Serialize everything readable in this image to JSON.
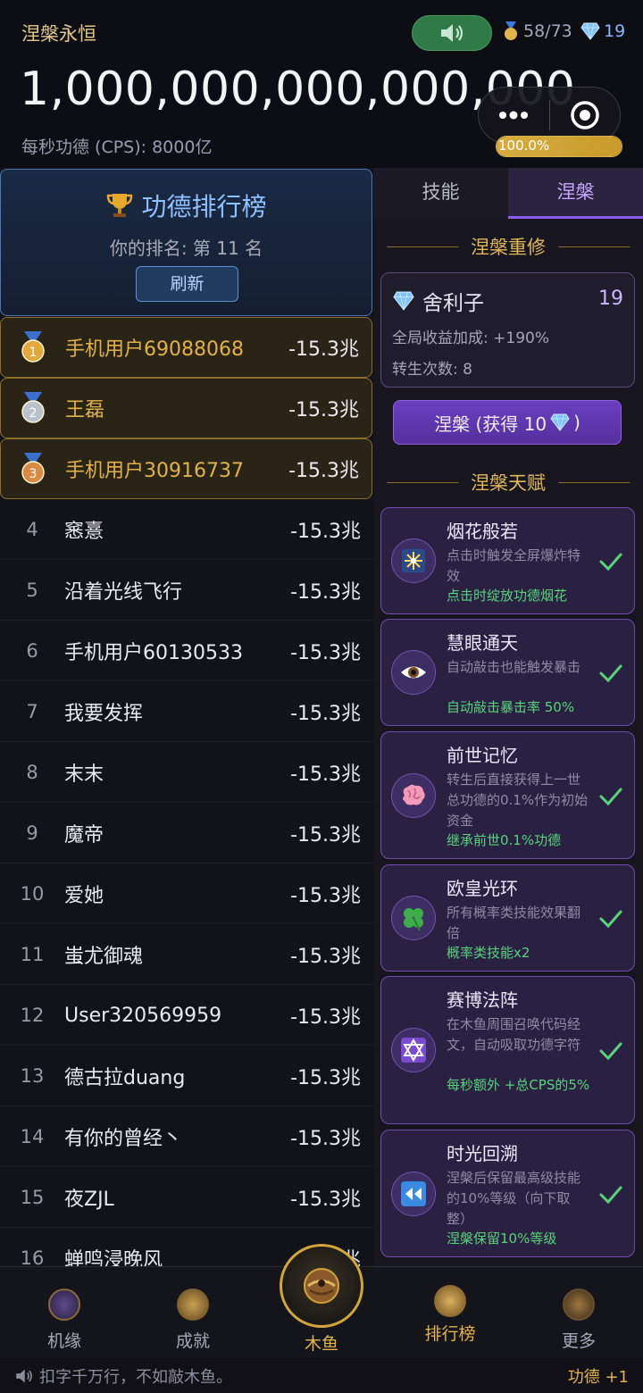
{
  "header": {
    "app_title": "涅槃永恒",
    "medals": "58/73",
    "gems": "19",
    "merit_total": "1,000,000,000,000,000",
    "cps": "每秒功德 (CPS): 8000亿",
    "progress_text": "100.0%",
    "progress_fraction": 1.0
  },
  "leaderboard": {
    "title": "功德排行榜",
    "my_rank": "你的排名: 第 11 名",
    "refresh_label": "刷新",
    "rows": [
      {
        "rank": "1",
        "name": "手机用户69088068",
        "score": "-15.3兆"
      },
      {
        "rank": "2",
        "name": "王磊",
        "score": "-15.3兆"
      },
      {
        "rank": "3",
        "name": "手机用户30916737",
        "score": "-15.3兆"
      },
      {
        "rank": "4",
        "name": "窸憙",
        "score": "-15.3兆"
      },
      {
        "rank": "5",
        "name": "沿着光线飞行",
        "score": "-15.3兆"
      },
      {
        "rank": "6",
        "name": "手机用户60130533",
        "score": "-15.3兆"
      },
      {
        "rank": "7",
        "name": "我要发挥",
        "score": "-15.3兆"
      },
      {
        "rank": "8",
        "name": "末末",
        "score": "-15.3兆"
      },
      {
        "rank": "9",
        "name": "魔帝",
        "score": "-15.3兆"
      },
      {
        "rank": "10",
        "name": "爱她",
        "score": "-15.3兆"
      },
      {
        "rank": "11",
        "name": "蚩尤御魂",
        "score": "-15.3兆"
      },
      {
        "rank": "12",
        "name": "User320569959",
        "score": "-15.3兆"
      },
      {
        "rank": "13",
        "name": "德古拉duang",
        "score": "-15.3兆"
      },
      {
        "rank": "14",
        "name": "有你的曾经丶",
        "score": "-15.3兆"
      },
      {
        "rank": "15",
        "name": "夜ZJL",
        "score": "-15.3兆"
      },
      {
        "rank": "16",
        "name": "蝉鸣浸晚风",
        "score": "兆"
      }
    ]
  },
  "panel": {
    "tabs": [
      "技能",
      "涅槃"
    ],
    "active_tab": 1,
    "section_rebirth": "涅槃重修",
    "relic": {
      "name": "舍利子",
      "count": "19",
      "bonus": "全局收益加成: +190%",
      "rebirths": "转生次数: 8"
    },
    "nirvana_button": "涅槃 (获得 10",
    "nirvana_button_end": ")",
    "section_talent": "涅槃天赋",
    "talents": [
      {
        "name": "烟花般若",
        "desc": "点击时触发全屏爆炸特效",
        "effect": "点击时绽放功德烟花",
        "icon": "fireworks-icon"
      },
      {
        "name": "慧眼通天",
        "desc": "自动敲击也能触发暴击",
        "effect": "自动敲击暴击率 50%",
        "icon": "eye-icon"
      },
      {
        "name": "前世记忆",
        "desc": "转生后直接获得上一世总功德的0.1%作为初始资金",
        "effect": "继承前世0.1%功德",
        "icon": "brain-icon"
      },
      {
        "name": "欧皇光环",
        "desc": "所有概率类技能效果翻倍",
        "effect": "概率类技能x2",
        "icon": "clover-icon"
      },
      {
        "name": "赛博法阵",
        "desc": "在木鱼周围召唤代码经文，自动吸取功德字符",
        "effect": "每秒额外 +总CPS的5%",
        "icon": "star-of-david-icon"
      },
      {
        "name": "时光回溯",
        "desc": "涅槃后保留最高级技能的10%等级（向下取整）",
        "effect": "涅槃保留10%等级",
        "icon": "rewind-icon"
      }
    ]
  },
  "nav": {
    "items": [
      "机缘",
      "成就",
      "木鱼",
      "排行榜",
      "更多"
    ],
    "active": 3
  },
  "ticker": {
    "text": "扣字千万行，不如敲木鱼。",
    "right": "功德 +1"
  },
  "colors": {
    "gold": "#e3b34c",
    "purple": "#8c5cf0",
    "green": "#57d37a",
    "blue": "#4b77b8"
  }
}
